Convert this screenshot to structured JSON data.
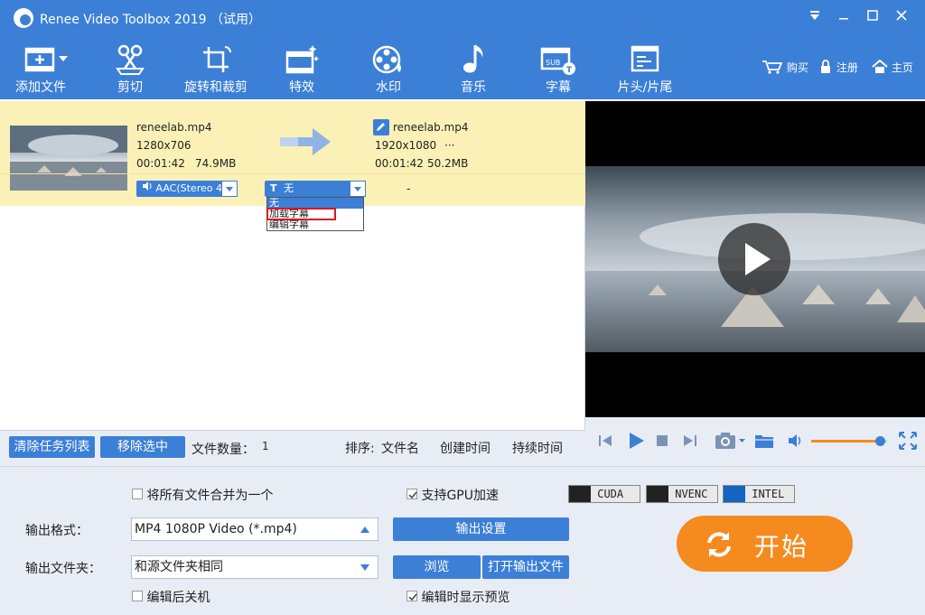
{
  "window": {
    "title": "Renee Video Toolbox 2019 （试用）",
    "controls": [
      "dropdown",
      "minimize",
      "maximize",
      "close"
    ]
  },
  "toolbar": {
    "items": [
      {
        "label": "添加文件",
        "icon": "add-file-icon"
      },
      {
        "label": "剪切",
        "icon": "scissors-icon"
      },
      {
        "label": "旋转和裁剪",
        "icon": "rotate-crop-icon"
      },
      {
        "label": "特效",
        "icon": "effects-icon"
      },
      {
        "label": "水印",
        "icon": "watermark-icon"
      },
      {
        "label": "音乐",
        "icon": "music-icon"
      },
      {
        "label": "字幕",
        "icon": "subtitle-icon"
      },
      {
        "label": "片头/片尾",
        "icon": "intro-outro-icon"
      }
    ],
    "links": [
      {
        "label": "购买",
        "icon": "cart-icon"
      },
      {
        "label": "注册",
        "icon": "lock-icon"
      },
      {
        "label": "主页",
        "icon": "home-icon"
      }
    ]
  },
  "file": {
    "source": {
      "name": "reneelab.mp4",
      "resolution": "1280x706",
      "duration": "00:01:42",
      "size": "74.9MB"
    },
    "output": {
      "name": "reneelab.mp4",
      "resolution": "1920x1080",
      "more": "···",
      "duration": "00:01:42",
      "size": "50.2MB"
    },
    "audio": "AAC(Stereo 4",
    "subtitle": "无",
    "dash": "-"
  },
  "subtitle_dropdown": {
    "options": [
      "无",
      "加载字幕",
      "编辑字幕"
    ],
    "highlighted": "加载字幕"
  },
  "listbar": {
    "clear_btn": "清除任务列表",
    "remove_btn": "移除选中",
    "count_label": "文件数量：",
    "count": "1",
    "sort_label": "排序:",
    "sort_options": [
      "文件名",
      "创建时间",
      "持续时间"
    ]
  },
  "player": {
    "buttons": [
      "prev-icon",
      "play-icon",
      "stop-icon",
      "next-icon",
      "camera-icon",
      "folder-icon",
      "volume-icon",
      "fullscreen-icon"
    ],
    "volume": 0.9
  },
  "settings": {
    "merge_label": "将所有文件合并为一个",
    "merge_checked": false,
    "gpu_label": "支持GPU加速",
    "gpu_checked": true,
    "badges": [
      "CUDA",
      "NVENC",
      "INTEL"
    ],
    "format_label": "输出格式：",
    "format_value": "MP4 1080P Video (*.mp4)",
    "output_settings_btn": "输出设置",
    "folder_label": "输出文件夹：",
    "folder_value": "和源文件夹相同",
    "browse_btn": "浏览",
    "open_folder_btn": "打开输出文件",
    "shutdown_label": "编辑后关机",
    "shutdown_checked": false,
    "preview_label": "编辑时显示预览",
    "preview_checked": true,
    "start_btn": "开始"
  },
  "colors": {
    "accent": "#3c7fd6",
    "row_highlight": "#fbf1b6",
    "start_button": "#f58a1f",
    "panel_bg": "#e8edf5"
  }
}
